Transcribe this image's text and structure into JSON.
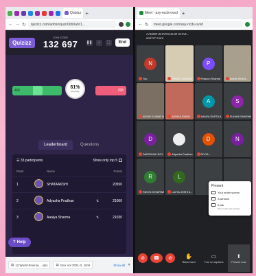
{
  "quizizz": {
    "tab_title": "Quizizz",
    "url": "quizizz.com/admin/quiz/60b9a9c1...",
    "logo": "Quizizz",
    "join_code_label": "JOIN CODE",
    "join_code": "132 697",
    "end_label": "End",
    "correct_count": "466",
    "incorrect_count": "295",
    "accuracy_pct": "61%",
    "accuracy_label": "Accuracy",
    "accuracy_fraction": 0.61,
    "tabs": [
      "Leaderboard",
      "Questions"
    ],
    "participants": "33 participants",
    "show_top": "Show only top 5",
    "columns": {
      "rank": "Rank",
      "name": "Name",
      "points": "Points"
    },
    "rows": [
      {
        "rank": "1",
        "name": "SHATAAKSHI",
        "points": "20550"
      },
      {
        "rank": "2",
        "name": "Adyasha Pradhan",
        "points": "21060"
      },
      {
        "rank": "3",
        "name": "Aaalya Sharma",
        "points": "21030"
      }
    ],
    "help_label": "Help"
  },
  "downloads": {
    "items": [
      "12 World Environ....xlsx",
      "Geo Vol 2021-3...html"
    ],
    "show_all": "Show all"
  },
  "meet": {
    "tab_title": "Meet - asy-ncds-ovsd",
    "url": "meet.google.com/asy-ncds-ovsd",
    "title": "AAMOR BHATNAGAR SHAZ...",
    "title_sub": "and 17 more",
    "tiles": [
      {
        "name": "You",
        "initial": "N",
        "color": "#c0392b",
        "video": false
      },
      {
        "name": "SHIVAY DANESH SH...",
        "initial": "",
        "color": "",
        "video": true,
        "kind": "video"
      },
      {
        "name": "Prasoon Sharma",
        "initial": "P",
        "color": "#7c4dff",
        "video": false
      },
      {
        "name": "Navya Shubhi...",
        "initial": "",
        "color": "",
        "video": true,
        "kind": "video2"
      },
      {
        "name": "ADVAY KUMAR N...",
        "initial": "",
        "color": "",
        "video": true,
        "kind": "video3"
      },
      {
        "name": "ANVIKA SINGH",
        "initial": "",
        "color": "",
        "video": true,
        "kind": "video4"
      },
      {
        "name": "AAMYA GUPTA 8...",
        "initial": "A",
        "color": "#0097a7",
        "video": false
      },
      {
        "name": "SUHANI SHARMA",
        "initial": "S",
        "color": "#8e24aa",
        "video": false
      },
      {
        "name": "DARSHVAK ROY ...",
        "initial": "D",
        "color": "#7b1fa2",
        "video": false
      },
      {
        "name": "Adyasha Pradhan",
        "initial": "",
        "color": "#eeeeee",
        "video": false
      },
      {
        "name": "DIVYA...",
        "initial": "D",
        "color": "#e65100",
        "video": false
      },
      {
        "name": "",
        "initial": "N",
        "color": "#7b1fa2",
        "video": false
      },
      {
        "name": "RAVYA KESARWA...",
        "initial": "R",
        "color": "#2e7d32",
        "video": false
      },
      {
        "name": "LAVYA JOSHI 8...",
        "initial": "L",
        "color": "#33691e",
        "video": false
      },
      {
        "name": "",
        "initial": "",
        "color": "",
        "video": false
      },
      {
        "name": "",
        "initial": "",
        "color": "",
        "video": false
      }
    ],
    "present_menu": {
      "title": "Present",
      "options": [
        {
          "label": "Your entire screen",
          "sub": ""
        },
        {
          "label": "A window",
          "sub": ""
        },
        {
          "label": "A tab",
          "sub": "Best for video and animation"
        }
      ]
    },
    "toolbar": {
      "raise_hand": "Raise hand",
      "captions": "Turn on captions",
      "present": "Present now"
    }
  }
}
